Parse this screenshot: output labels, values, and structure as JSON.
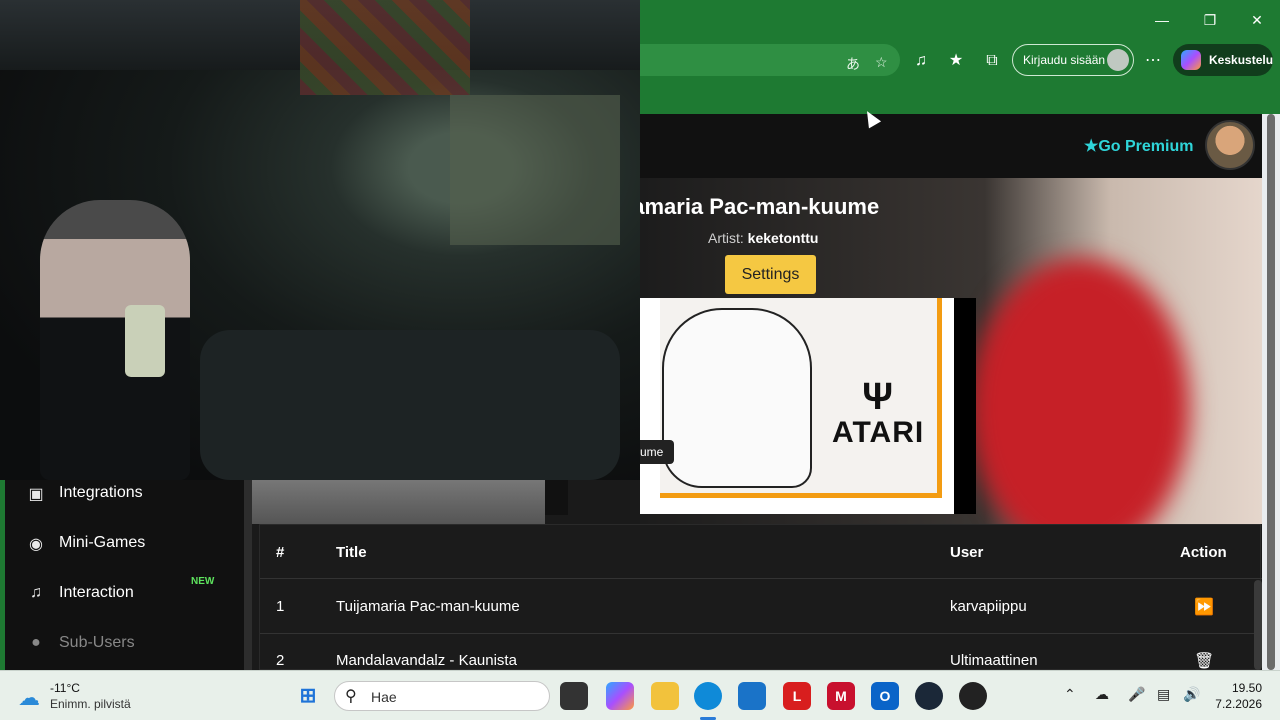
{
  "browser": {
    "signin_label": "Kirjaudu sisään",
    "copilot_label": "Keskustelu",
    "icons": [
      "translate-icon",
      "favorite-star-icon",
      "music-icon",
      "favorites-icon",
      "collections-icon",
      "more-icon"
    ]
  },
  "site": {
    "premium_label": "Go Premium",
    "song_title": "ijamaria Pac-man-kuume",
    "artist_label": "Artist:",
    "artist_name": "keketonttu",
    "settings_label": "Settings",
    "art_brand": "ATARI",
    "art_pill": "ume"
  },
  "sidebar": {
    "items": [
      {
        "label": "Integrations",
        "icon": "integrations-icon"
      },
      {
        "label": "Mini-Games",
        "icon": "gamepad-icon"
      },
      {
        "label": "Interaction",
        "icon": "music-note-icon",
        "badge": "NEW"
      },
      {
        "label": "Sub-Users",
        "icon": "users-icon"
      }
    ]
  },
  "queue": {
    "headers": {
      "num": "#",
      "title": "Title",
      "user": "User",
      "action": "Action"
    },
    "rows": [
      {
        "num": "1",
        "title": "Tuijamaria Pac-man-kuume",
        "user": "karvapiippu",
        "action_icon": "play-next-icon"
      },
      {
        "num": "2",
        "title": "Mandalavandalz - Kaunista",
        "user": "Ultimaattinen",
        "action_icon": "trash-icon"
      }
    ]
  },
  "taskbar": {
    "temperature": "-11°C",
    "weather": "Enimm. pilvistä",
    "search_placeholder": "Hae",
    "time": "19.50",
    "date": "7.2.2026"
  },
  "colors": {
    "browser_green": "#1e7a32",
    "premium_cyan": "#2fd5d9",
    "settings_yellow": "#f5c842",
    "new_badge_green": "#5ee35e"
  }
}
